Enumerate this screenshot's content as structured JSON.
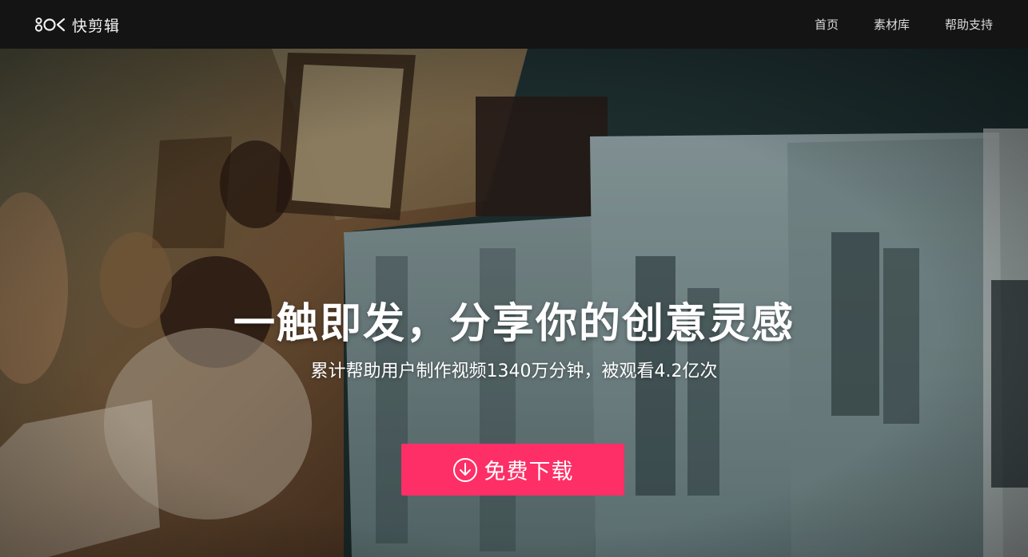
{
  "header": {
    "logo_text": "快剪辑",
    "logo_icon": "kuai-logo-icon",
    "nav": [
      {
        "label": "首页"
      },
      {
        "label": "素材库"
      },
      {
        "label": "帮助支持"
      }
    ]
  },
  "hero": {
    "title": "一触即发，分享你的创意灵感",
    "subtitle": "累计帮助用户制作视频1340万分钟，被观看4.2亿次",
    "download_label": "免费下载",
    "download_icon": "download-circle-icon"
  },
  "colors": {
    "nav_bg": "#141414",
    "accent": "#fd2f66"
  }
}
